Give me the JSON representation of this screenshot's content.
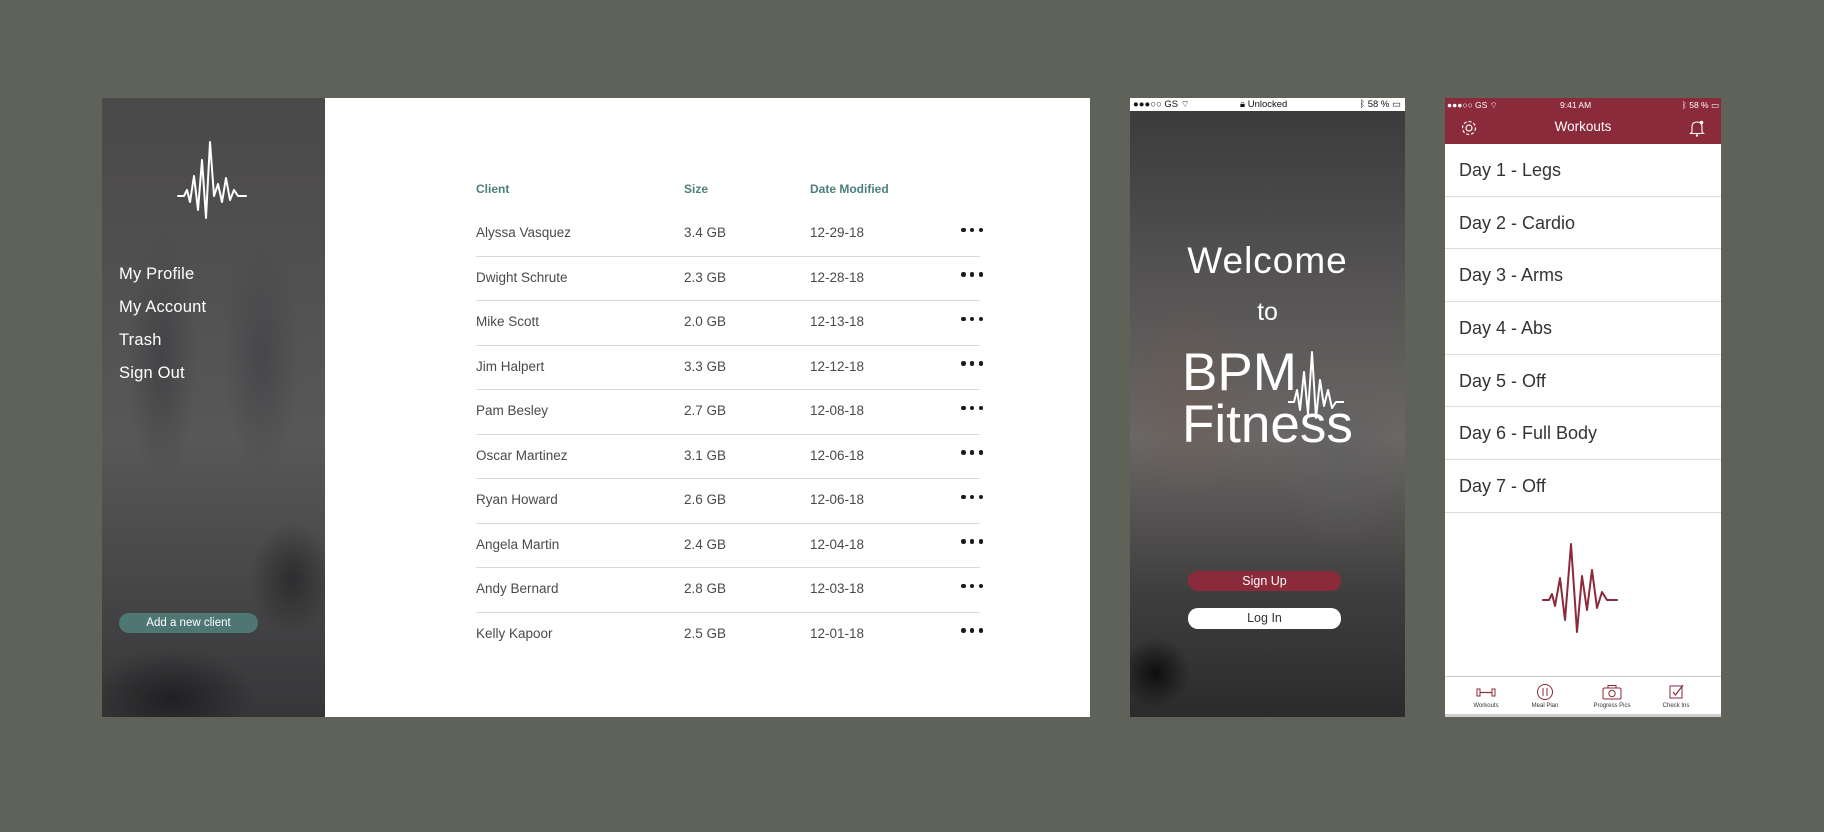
{
  "desktop": {
    "sidebar": {
      "menu": [
        "My Profile",
        "My Account",
        "Trash",
        "Sign Out"
      ],
      "add_client_label": "Add a new client"
    },
    "table": {
      "headers": {
        "client": "Client",
        "size": "Size",
        "date": "Date Modified"
      },
      "rows": [
        {
          "client": "Alyssa Vasquez",
          "size": "3.4 GB",
          "date": "12-29-18"
        },
        {
          "client": "Dwight Schrute",
          "size": "2.3 GB",
          "date": "12-28-18"
        },
        {
          "client": "Mike Scott",
          "size": "2.0 GB",
          "date": "12-13-18"
        },
        {
          "client": "Jim Halpert",
          "size": "3.3 GB",
          "date": "12-12-18"
        },
        {
          "client": "Pam Besley",
          "size": "2.7 GB",
          "date": "12-08-18"
        },
        {
          "client": "Oscar Martinez",
          "size": "3.1 GB",
          "date": "12-06-18"
        },
        {
          "client": "Ryan Howard",
          "size": "2.6 GB",
          "date": "12-06-18"
        },
        {
          "client": "Angela Martin",
          "size": "2.4 GB",
          "date": "12-04-18"
        },
        {
          "client": "Andy Bernard",
          "size": "2.8 GB",
          "date": "12-03-18"
        },
        {
          "client": "Kelly Kapoor",
          "size": "2.5 GB",
          "date": "12-01-18"
        }
      ]
    }
  },
  "welcome_phone": {
    "status": {
      "carrier": "●●●○○ GS",
      "center": "Unlocked",
      "battery": "58 %"
    },
    "welcome": "Welcome",
    "to": "to",
    "brand_line1": "BPM",
    "brand_line2": "Fitness",
    "signup_label": "Sign Up",
    "login_label": "Log In"
  },
  "workouts_phone": {
    "status": {
      "carrier": "●●●○○ GS",
      "time": "9:41 AM",
      "battery": "58 %"
    },
    "title": "Workouts",
    "days": [
      "Day 1 - Legs",
      "Day 2 - Cardio",
      "Day 3 - Arms",
      "Day 4 - Abs",
      "Day 5 - Off",
      "Day 6 - Full Body",
      "Day 7 - Off"
    ],
    "tabs": [
      "Workouts",
      "Meal Plan",
      "Progress Pics",
      "Check Ins"
    ]
  },
  "colors": {
    "background": "#5f6259",
    "accent_teal": "#4b7f7b",
    "accent_maroon": "#8b2a3a"
  }
}
